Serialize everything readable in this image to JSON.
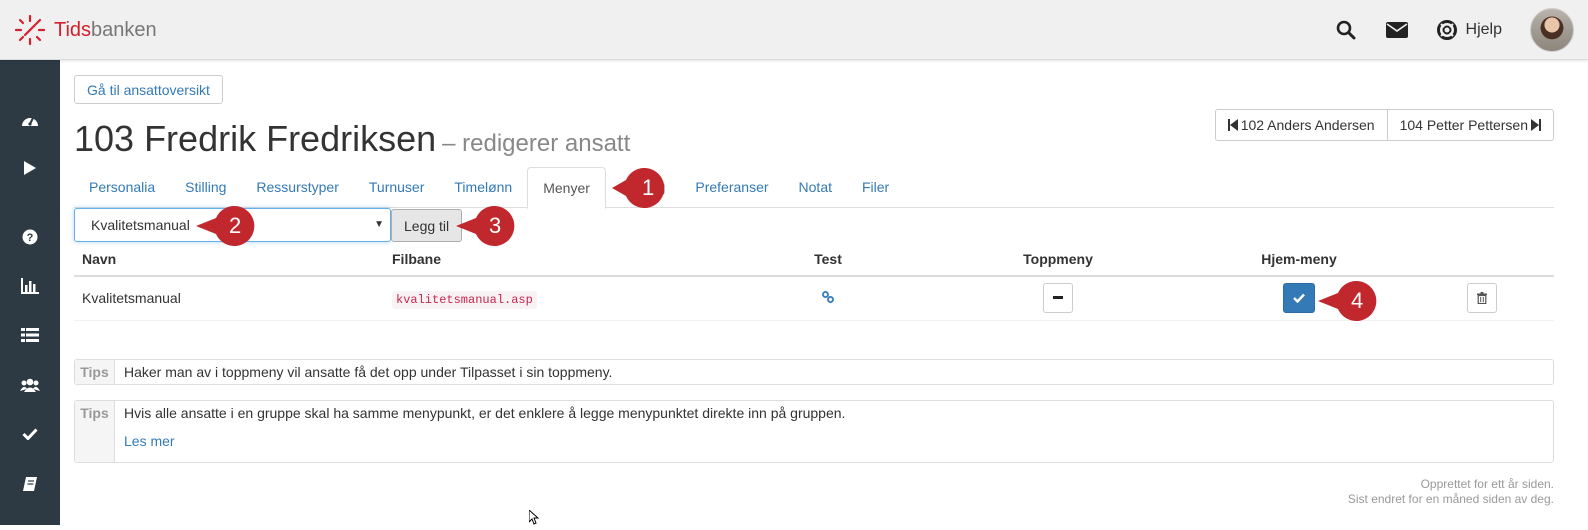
{
  "header": {
    "logo_text_a": "Tids",
    "logo_text_b": "banken",
    "help_label": "Hjelp",
    "icons": [
      "search-icon",
      "envelope-icon",
      "lifebuoy-icon"
    ]
  },
  "sidebar": {
    "items": [
      "dashboard-icon",
      "play-icon",
      "help-icon",
      "bar-chart-icon",
      "list-icon",
      "users-icon",
      "check-icon",
      "book-icon"
    ]
  },
  "page": {
    "overview_button": "Gå til ansattoversikt",
    "title": "103 Fredrik Fredriksen",
    "subtitle": "– redigerer ansatt",
    "prev_employee": "102 Anders Andersen",
    "next_employee": "104 Petter Pettersen"
  },
  "tabs": [
    {
      "label": "Personalia",
      "active": false
    },
    {
      "label": "Stilling",
      "active": false
    },
    {
      "label": "Ressurstyper",
      "active": false
    },
    {
      "label": "Turnuser",
      "active": false
    },
    {
      "label": "Timelønn",
      "active": false
    },
    {
      "label": "Menyer",
      "active": true
    },
    {
      "label": "...g",
      "active": false
    },
    {
      "label": "Preferanser",
      "active": false
    },
    {
      "label": "Notat",
      "active": false
    },
    {
      "label": "Filer",
      "active": false
    }
  ],
  "menu_select": {
    "selected": "Kvalitetsmanual",
    "add_label": "Legg til"
  },
  "table": {
    "headers": {
      "name": "Navn",
      "path": "Filbane",
      "test": "Test",
      "top": "Toppmeny",
      "home": "Hjem-meny"
    },
    "rows": [
      {
        "name": "Kvalitetsmanual",
        "path": "kvalitetsmanual.asp",
        "top_menu": false,
        "home_menu": true
      }
    ]
  },
  "tips": [
    {
      "label": "Tips",
      "text": "Haker man av i toppmeny vil ansatte få det opp under Tilpasset i sin toppmeny."
    },
    {
      "label": "Tips",
      "text": "Hvis alle ansatte i en gruppe skal ha samme menypunkt, er det enklere å legge menypunktet direkte inn på gruppen.",
      "link": "Les mer"
    }
  ],
  "footer": {
    "created": "Opprettet for ett år siden.",
    "changed": "Sist endret for en måned siden av deg."
  },
  "callouts": [
    "1",
    "2",
    "3",
    "4"
  ],
  "colors": {
    "primary": "#337ab7",
    "brand_red": "#d4202d",
    "sidebar": "#2d3a44",
    "callout": "#c0282d"
  }
}
